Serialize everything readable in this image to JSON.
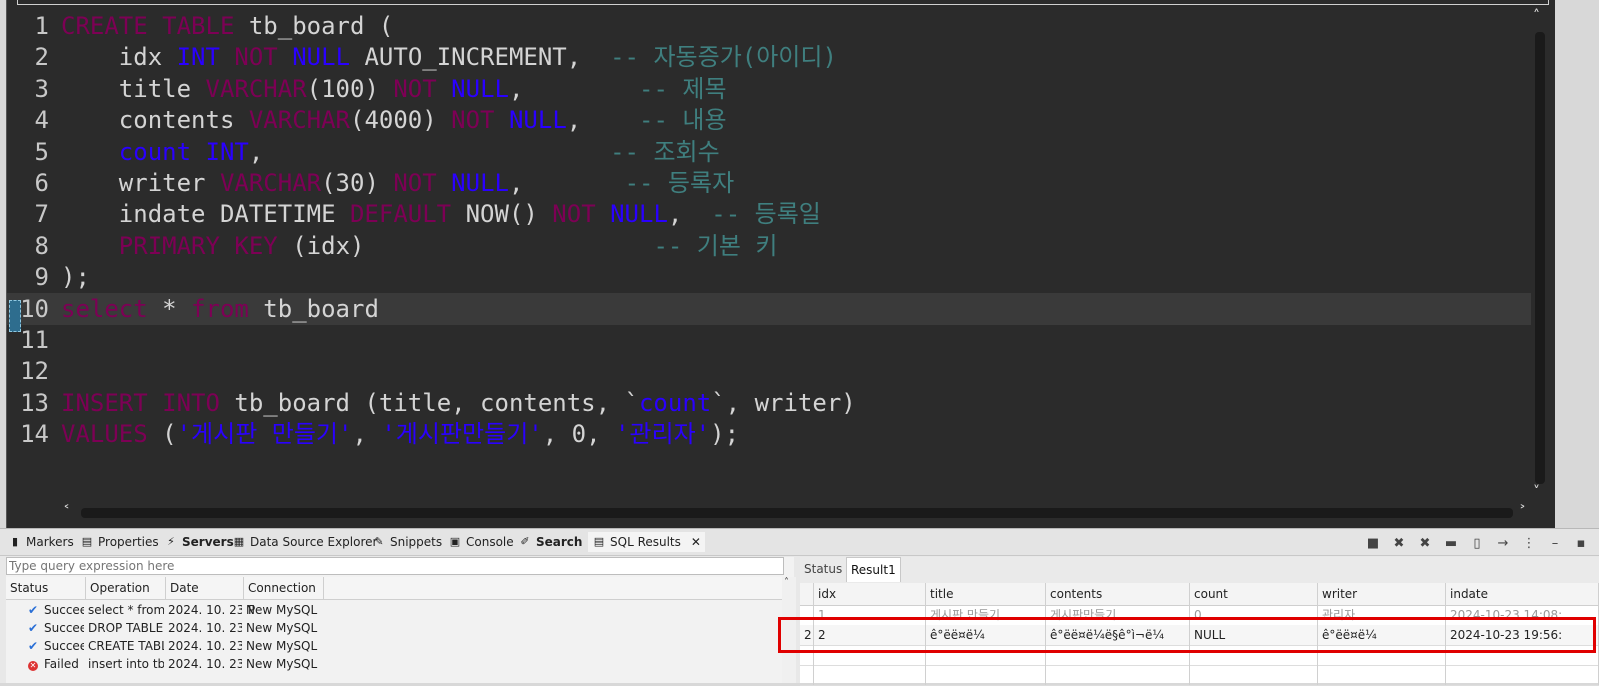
{
  "editor": {
    "lines": [
      {
        "num": "1",
        "tokens": [
          [
            "kw",
            "CREATE"
          ],
          [
            "fn",
            " "
          ],
          [
            "kw",
            "TABLE"
          ],
          [
            "fn",
            " tb_board ("
          ]
        ]
      },
      {
        "num": "2",
        "tokens": [
          [
            "fn",
            "    idx "
          ],
          [
            "ty",
            "INT"
          ],
          [
            "fn",
            " "
          ],
          [
            "kw",
            "NOT"
          ],
          [
            "fn",
            " "
          ],
          [
            "ty",
            "NULL"
          ],
          [
            "fn",
            " AUTO_INCREMENT,  "
          ],
          [
            "cm",
            "-- 자동증가(아이디)"
          ]
        ]
      },
      {
        "num": "3",
        "tokens": [
          [
            "fn",
            "    title "
          ],
          [
            "kw",
            "VARCHAR"
          ],
          [
            "fn",
            "(100) "
          ],
          [
            "kw",
            "NOT"
          ],
          [
            "fn",
            " "
          ],
          [
            "ty",
            "NULL"
          ],
          [
            "fn",
            ",        "
          ],
          [
            "cm",
            "-- 제목"
          ]
        ]
      },
      {
        "num": "4",
        "tokens": [
          [
            "fn",
            "    contents "
          ],
          [
            "kw",
            "VARCHAR"
          ],
          [
            "fn",
            "(4000) "
          ],
          [
            "kw",
            "NOT"
          ],
          [
            "fn",
            " "
          ],
          [
            "ty",
            "NULL"
          ],
          [
            "fn",
            ",    "
          ],
          [
            "cm",
            "-- 내용"
          ]
        ]
      },
      {
        "num": "5",
        "tokens": [
          [
            "fn",
            "    "
          ],
          [
            "ty",
            "count"
          ],
          [
            "fn",
            " "
          ],
          [
            "ty",
            "INT"
          ],
          [
            "fn",
            ",                        "
          ],
          [
            "cm",
            "-- 조회수"
          ]
        ]
      },
      {
        "num": "6",
        "tokens": [
          [
            "fn",
            "    writer "
          ],
          [
            "kw",
            "VARCHAR"
          ],
          [
            "fn",
            "(30) "
          ],
          [
            "kw",
            "NOT"
          ],
          [
            "fn",
            " "
          ],
          [
            "ty",
            "NULL"
          ],
          [
            "fn",
            ",       "
          ],
          [
            "cm",
            "-- 등록자"
          ]
        ]
      },
      {
        "num": "7",
        "tokens": [
          [
            "fn",
            "    indate DATETIME "
          ],
          [
            "kw",
            "DEFAULT"
          ],
          [
            "fn",
            " NOW() "
          ],
          [
            "kw",
            "NOT"
          ],
          [
            "fn",
            " "
          ],
          [
            "ty",
            "NULL"
          ],
          [
            "fn",
            ",  "
          ],
          [
            "cm",
            "-- 등록일"
          ]
        ]
      },
      {
        "num": "8",
        "tokens": [
          [
            "fn",
            "    "
          ],
          [
            "kw",
            "PRIMARY"
          ],
          [
            "fn",
            " "
          ],
          [
            "kw",
            "KEY"
          ],
          [
            "fn",
            " (idx)                    "
          ],
          [
            "cm",
            "-- 기본 키"
          ]
        ]
      },
      {
        "num": "9",
        "tokens": [
          [
            "fn",
            ");"
          ]
        ]
      },
      {
        "num": "10",
        "tokens": [
          [
            "kw",
            "select"
          ],
          [
            "fn",
            " * "
          ],
          [
            "kw",
            "from"
          ],
          [
            "fn",
            " tb_board"
          ]
        ]
      },
      {
        "num": "11",
        "tokens": []
      },
      {
        "num": "12",
        "tokens": []
      },
      {
        "num": "13",
        "tokens": [
          [
            "kw",
            "INSERT"
          ],
          [
            "fn",
            " "
          ],
          [
            "kw",
            "INTO"
          ],
          [
            "fn",
            " tb_board (title, contents, `"
          ],
          [
            "ty",
            "count"
          ],
          [
            "fn",
            "`, writer)"
          ]
        ]
      },
      {
        "num": "14",
        "tokens": [
          [
            "kw",
            "VALUES"
          ],
          [
            "fn",
            " ("
          ],
          [
            "str",
            "'게시판 만들기'"
          ],
          [
            "fn",
            ", "
          ],
          [
            "str",
            "'게시판만들기'"
          ],
          [
            "fn",
            ", 0, "
          ],
          [
            "str",
            "'관리자'"
          ],
          [
            "fn",
            ");"
          ]
        ]
      }
    ],
    "current_line": 10
  },
  "tabs": [
    {
      "label": "Markers",
      "icon": "markers-icon",
      "glyph": "▮"
    },
    {
      "label": "Properties",
      "icon": "properties-icon",
      "glyph": "▤"
    },
    {
      "label": "Servers",
      "icon": "servers-icon",
      "glyph": "⚡",
      "bold": true
    },
    {
      "label": "Data Source Explorer",
      "icon": "data-source-icon",
      "glyph": "▦"
    },
    {
      "label": "Snippets",
      "icon": "snippets-icon",
      "glyph": "✎"
    },
    {
      "label": "Console",
      "icon": "console-icon",
      "glyph": "▣"
    },
    {
      "label": "Search",
      "icon": "search-icon",
      "glyph": "✐",
      "bold": true
    },
    {
      "label": "SQL Results",
      "icon": "sql-results-icon",
      "glyph": "▤",
      "active": true,
      "close": "✕"
    }
  ],
  "history": {
    "placeholder": "Type query expression here",
    "columns": [
      "Status",
      "Operation",
      "Date",
      "Connection P"
    ],
    "rows": [
      {
        "status": "Succeeded",
        "icon": "ok",
        "operation": "select * from tb_board",
        "date": "2024. 10. 23",
        "connection": "New MySQL"
      },
      {
        "status": "Succeeded",
        "icon": "ok",
        "operation": "DROP TABLE tb_board",
        "date": "2024. 10. 23",
        "connection": "New MySQL"
      },
      {
        "status": "Succeeded",
        "icon": "ok",
        "operation": "CREATE TABLE tb_board",
        "date": "2024. 10. 23",
        "connection": "New MySQL"
      },
      {
        "status": "Failed",
        "icon": "fail",
        "operation": "insert into tb_board",
        "date": "2024. 10. 23",
        "connection": "New MySQL"
      }
    ]
  },
  "results": {
    "tabs": [
      "Status",
      "Result1"
    ],
    "columns": [
      "idx",
      "title",
      "contents",
      "count",
      "writer",
      "indate"
    ],
    "rows": [
      {
        "rownum": "",
        "idx": "1",
        "title": "게시판 만들기",
        "contents": "게시판만들기",
        "count": "0",
        "writer": "관리자",
        "indate": "2024-10-23 14:08:"
      },
      {
        "rownum": "2",
        "idx": "2",
        "title": "ê°ëë¤ë¼",
        "contents": "ê°ëë¤ë¼ë§ê°ì¬ë¼",
        "count": "NULL",
        "writer": "ê°ëë¤ë¼",
        "indate": "2024-10-23 19:56:"
      }
    ]
  }
}
